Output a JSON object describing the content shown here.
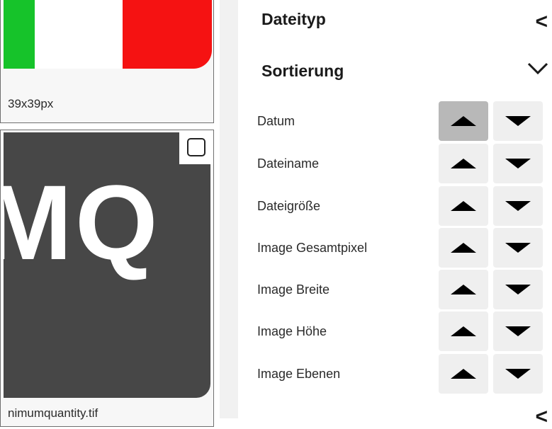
{
  "files": [
    {
      "caption": "39x39px",
      "selected": false
    },
    {
      "caption": "nimumquantity.tif",
      "thumb_text": "MQ",
      "selected": false
    }
  ],
  "panel": {
    "dateityp_label": "Dateityp",
    "sortierung_label": "Sortierung",
    "sort_options": [
      {
        "label": "Datum",
        "active": "up"
      },
      {
        "label": "Dateiname",
        "active": ""
      },
      {
        "label": "Dateigröße",
        "active": ""
      },
      {
        "label": "Image Gesamtpixel",
        "active": ""
      },
      {
        "label": "Image Breite",
        "active": ""
      },
      {
        "label": "Image Höhe",
        "active": ""
      },
      {
        "label": "Image Ebenen",
        "active": ""
      }
    ]
  },
  "colors": {
    "flag_green": "#16c32a",
    "flag_red": "#f51212",
    "active_button": "#b8b8b8",
    "button": "#efefef"
  }
}
